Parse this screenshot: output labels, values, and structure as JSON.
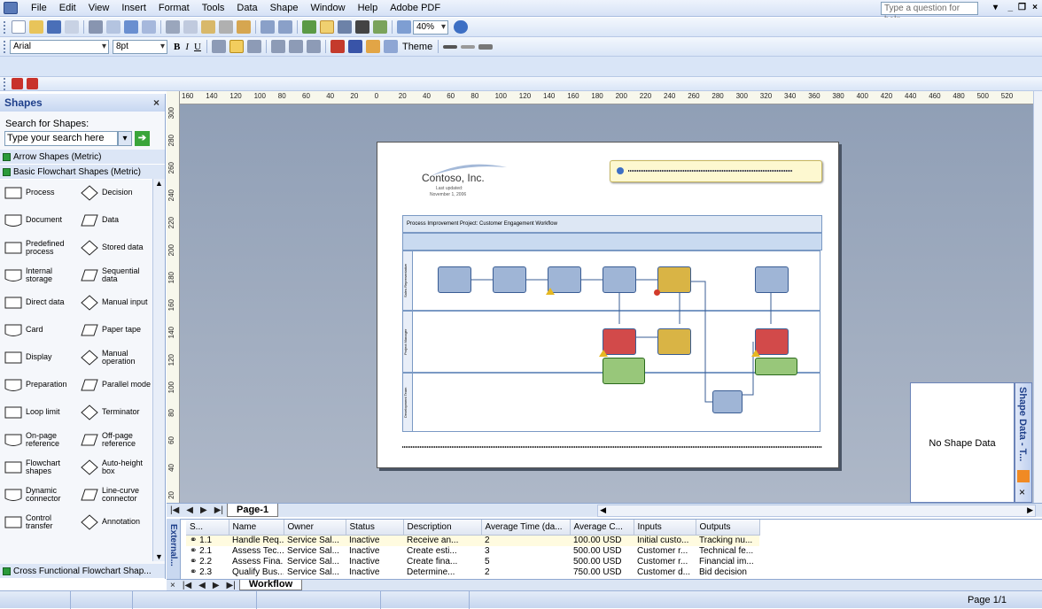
{
  "menu": {
    "items": [
      "File",
      "Edit",
      "View",
      "Insert",
      "Format",
      "Tools",
      "Data",
      "Shape",
      "Window",
      "Help",
      "Adobe PDF"
    ],
    "help_placeholder": "Type a question for help",
    "window_controls": [
      "_",
      "❐",
      "×"
    ]
  },
  "toolbar": {
    "zoom": "40%",
    "font": "Arial",
    "font_size": "8pt",
    "theme_label": "Theme"
  },
  "shapes_pane": {
    "title": "Shapes",
    "close": "×",
    "search_label": "Search for Shapes:",
    "search_placeholder": "Type your search here",
    "stencils": [
      "Arrow Shapes (Metric)",
      "Basic Flowchart Shapes (Metric)"
    ],
    "bottom_stencil": "Cross Functional Flowchart Shap...",
    "shapes": [
      [
        "Process",
        "Decision"
      ],
      [
        "Document",
        "Data"
      ],
      [
        "Predefined process",
        "Stored data"
      ],
      [
        "Internal storage",
        "Sequential data"
      ],
      [
        "Direct data",
        "Manual input"
      ],
      [
        "Card",
        "Paper tape"
      ],
      [
        "Display",
        "Manual operation"
      ],
      [
        "Preparation",
        "Parallel mode"
      ],
      [
        "Loop limit",
        "Terminator"
      ],
      [
        "On-page reference",
        "Off-page reference"
      ],
      [
        "Flowchart shapes",
        "Auto-height box"
      ],
      [
        "Dynamic connector",
        "Line-curve connector"
      ],
      [
        "Control transfer",
        "Annotation"
      ]
    ]
  },
  "ruler": {
    "top": [
      "160",
      "140",
      "120",
      "100",
      "80",
      "60",
      "40",
      "20",
      "0",
      "20",
      "40",
      "60",
      "80",
      "100",
      "120",
      "140",
      "160",
      "180",
      "200",
      "220",
      "240",
      "260",
      "280",
      "300",
      "320",
      "340",
      "360",
      "380",
      "400",
      "420",
      "440",
      "460",
      "480",
      "500",
      "520"
    ],
    "left": [
      "300",
      "280",
      "260",
      "240",
      "220",
      "200",
      "180",
      "160",
      "140",
      "120",
      "100",
      "80",
      "60",
      "40",
      "20"
    ]
  },
  "diagram": {
    "company": "Contoso, Inc.",
    "updated_label": "Last updated:",
    "updated_date": "November 1, 2006",
    "title": "Process Improvement Project: Customer Engagement Workflow",
    "lanes": [
      "Sales Representative",
      "Project Manager",
      "Development Team"
    ]
  },
  "shape_data": {
    "text": "No Shape Data",
    "tab_label": "Shape Data - T..."
  },
  "page_tabs": {
    "tab": "Page-1"
  },
  "external_data": {
    "side_label": "External...",
    "columns": [
      "S...",
      "Name",
      "Owner",
      "Status",
      "Description",
      "Average Time (da...",
      "Average C...",
      "Inputs",
      "Outputs"
    ],
    "rows": [
      [
        "1.1",
        "Handle Req...",
        "Service Sal...",
        "Inactive",
        "Receive an...",
        "2",
        "100.00 USD",
        "Initial custo...",
        "Tracking nu..."
      ],
      [
        "2.1",
        "Assess Tec...",
        "Service Sal...",
        "Inactive",
        "Create esti...",
        "3",
        "500.00 USD",
        "Customer r...",
        "Technical fe..."
      ],
      [
        "2.2",
        "Assess Fina...",
        "Service Sal...",
        "Inactive",
        "Create fina...",
        "5",
        "500.00 USD",
        "Customer r...",
        "Financial im..."
      ],
      [
        "2.3",
        "Qualify Bus...",
        "Service Sal...",
        "Inactive",
        "Determine...",
        "2",
        "750.00 USD",
        "Customer d...",
        "Bid decision"
      ]
    ],
    "tab": "Workflow"
  },
  "status": {
    "page": "Page 1/1"
  },
  "colors": {
    "blue_box": "#9fb5d6",
    "yellow_box": "#d9b445",
    "red_box": "#d24a4a",
    "green_box": "#98c77a",
    "accent": "#1e3f8a"
  }
}
